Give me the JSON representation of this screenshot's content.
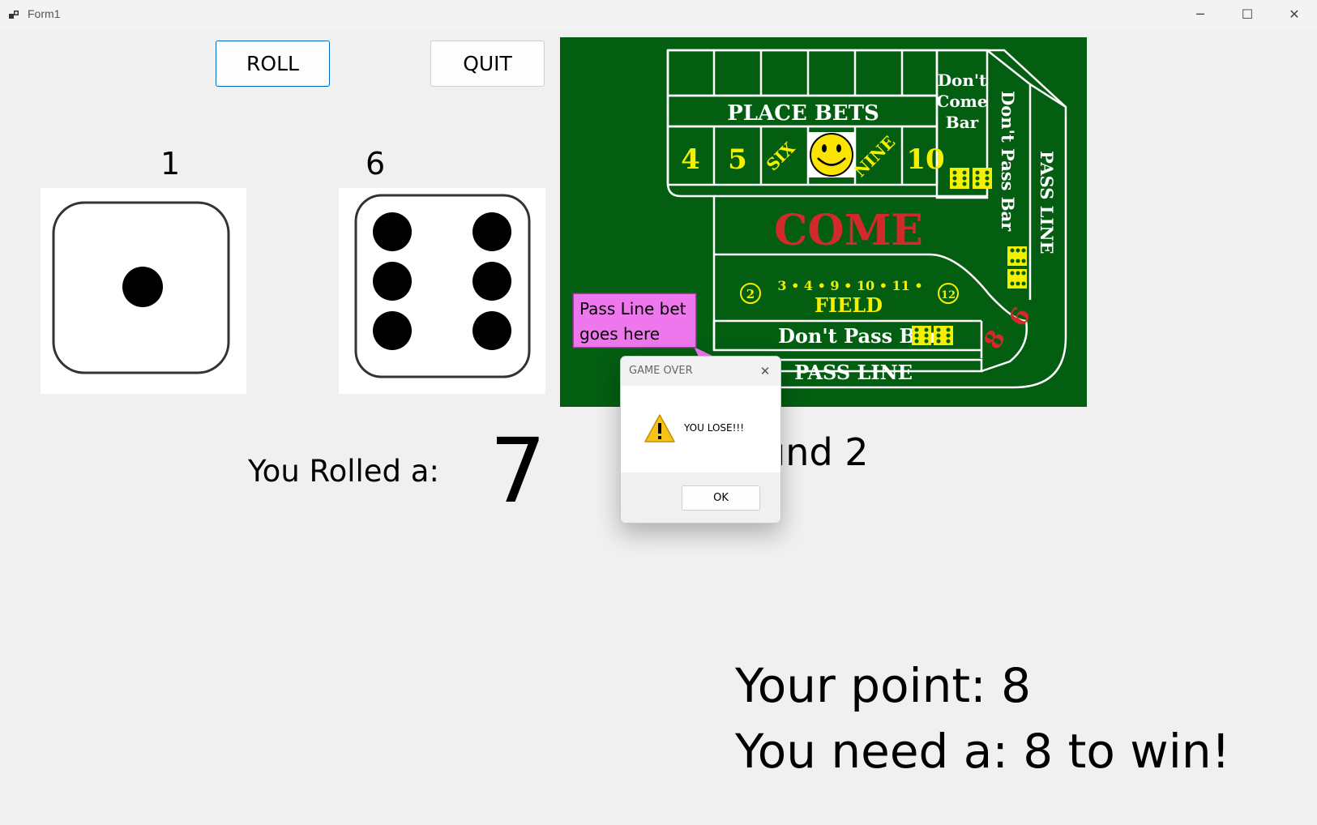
{
  "window": {
    "title": "Form1",
    "minimize": "─",
    "maximize": "☐",
    "close": "✕"
  },
  "toolbar": {
    "roll_label": "ROLL",
    "quit_label": "QUIT"
  },
  "dice": [
    {
      "label": "1",
      "value": 1
    },
    {
      "label": "6",
      "value": 6
    }
  ],
  "status": {
    "rolled_label": "You Rolled a:",
    "rolled_value": "7",
    "round_label": "ound 2",
    "point_label": "Your point: 8",
    "need_label": "You need a: 8 to win!"
  },
  "board": {
    "place_bets": "PLACE BETS",
    "numbers": [
      "4",
      "5",
      "SIX",
      "NINE",
      "10"
    ],
    "dont_come_bar": [
      "Don't",
      "Come",
      "Bar"
    ],
    "dont_pass_bar_vertical": "Don't Pass Bar",
    "pass_line_vertical": "PASS LINE",
    "come": "COME",
    "field_numbers": "3 • 4 • 9 • 10 • 11 •",
    "field_circle_left": "2",
    "field_circle_right": "12",
    "field": "FIELD",
    "dont_pass_bar": "Don't Pass Bar",
    "pass_line": "PASS LINE",
    "callout": [
      "Pass Line bet",
      "goes here"
    ],
    "big_numbers": [
      "6",
      "8"
    ],
    "colors": {
      "felt": "#035e12",
      "line": "#ffffff",
      "yellow": "#f4f000",
      "come_red": "#d22a2a",
      "callout": "#ee77ee"
    }
  },
  "dialog": {
    "title": "GAME OVER",
    "close": "✕",
    "message": "YOU LOSE!!!",
    "icon": "warning-icon",
    "ok_label": "OK"
  }
}
